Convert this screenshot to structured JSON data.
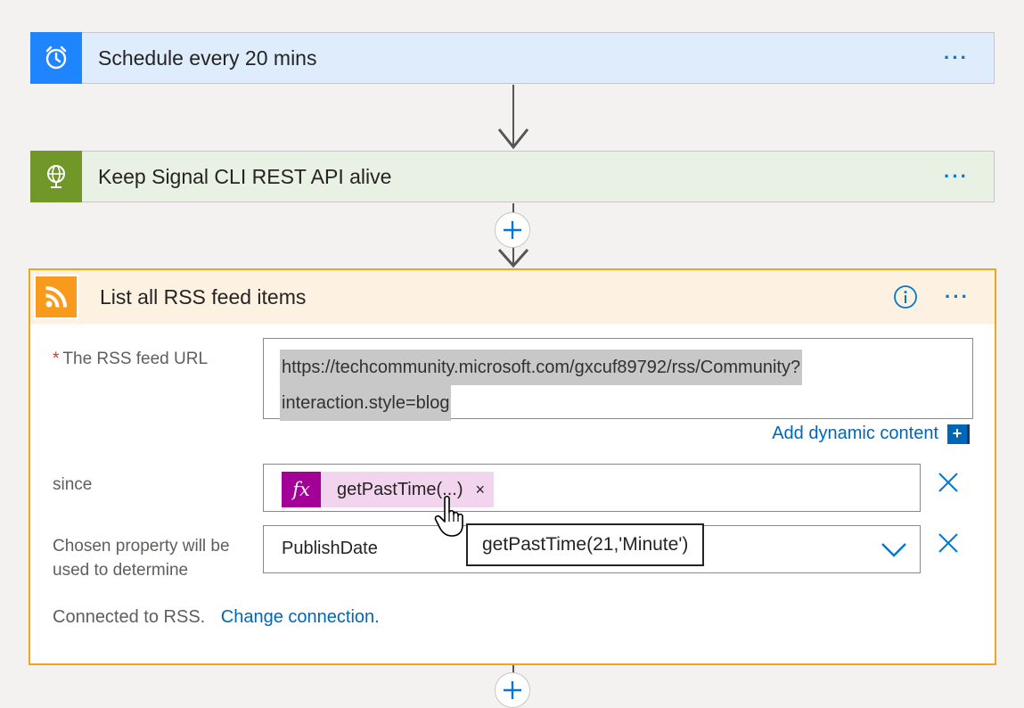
{
  "schedule_card": {
    "title": "Schedule every 20 mins",
    "more_label": "···",
    "icon": "alarm-clock-icon",
    "color": "#1f85ff"
  },
  "http_card": {
    "title": "Keep Signal CLI REST API alive",
    "more_label": "···",
    "icon": "globe-icon",
    "color": "#709727"
  },
  "rss_card": {
    "title": "List all RSS feed items",
    "icon": "rss-icon",
    "color": "#f89a1c",
    "border_color": "#f7a21d",
    "more_label": "···",
    "fields": {
      "feed_url": {
        "required_mark": "*",
        "label": "The RSS feed URL",
        "value_line1": "https://techcommunity.microsoft.com/gxcuf89792/rss/Community?",
        "value_line2": "interaction.style=blog"
      },
      "add_dynamic_content": "Add dynamic content",
      "add_dynamic_plus": "+",
      "since": {
        "label": "since",
        "token_icon": "fx",
        "token_text": "getPastTime(...)",
        "token_remove": "×"
      },
      "property": {
        "label_line1": "Chosen property will be",
        "label_line2": "used to determine",
        "value": "PublishDate"
      }
    },
    "tooltip": "getPastTime(21,'Minute')",
    "connection": {
      "text": "Connected to RSS.",
      "change_link": "Change connection."
    }
  },
  "colors": {
    "accent": "#0078d4",
    "link": "#0067b8",
    "expression": "#a30097"
  }
}
